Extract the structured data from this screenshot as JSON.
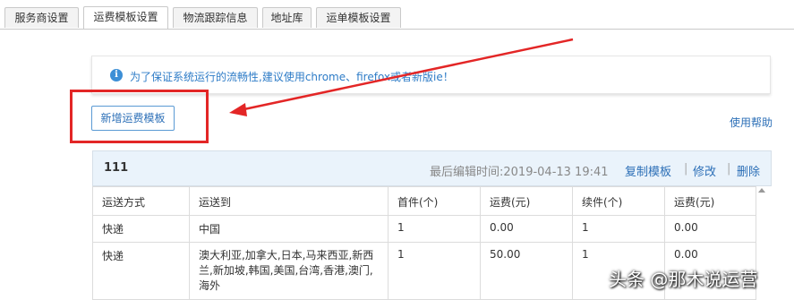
{
  "tabs": [
    {
      "label": "服务商设置",
      "active": false
    },
    {
      "label": "运费模板设置",
      "active": true
    },
    {
      "label": "物流跟踪信息",
      "active": false
    },
    {
      "label": "地址库",
      "active": false
    },
    {
      "label": "运单模板设置",
      "active": false
    }
  ],
  "notice": {
    "icon": "info-icon",
    "text": "为了保证系统运行的流畅性,建议使用chrome、firefox或者新版ie！"
  },
  "add_button_label": "新增运费模板",
  "help_link": "使用帮助",
  "template": {
    "name": "111",
    "last_edit_label": "最后编辑时间:2019-04-13 19:41",
    "actions": [
      "复制模板",
      "修改",
      "删除"
    ],
    "columns": [
      "运送方式",
      "运送到",
      "首件(个)",
      "运费(元)",
      "续件(个)",
      "运费(元)"
    ],
    "rows": [
      [
        "快递",
        "中国",
        "1",
        "0.00",
        "1",
        "0.00"
      ],
      [
        "快递",
        "澳大利亚,加拿大,日本,马来西亚,新西兰,新加坡,韩国,美国,台湾,香港,澳门,海外",
        "1",
        "50.00",
        "1",
        "0.00"
      ]
    ]
  },
  "watermark": "头条 @那木说运营",
  "colors": {
    "accent": "#2c6fb7",
    "annotation": "#e32626",
    "header_bg": "#eaf3fb"
  }
}
